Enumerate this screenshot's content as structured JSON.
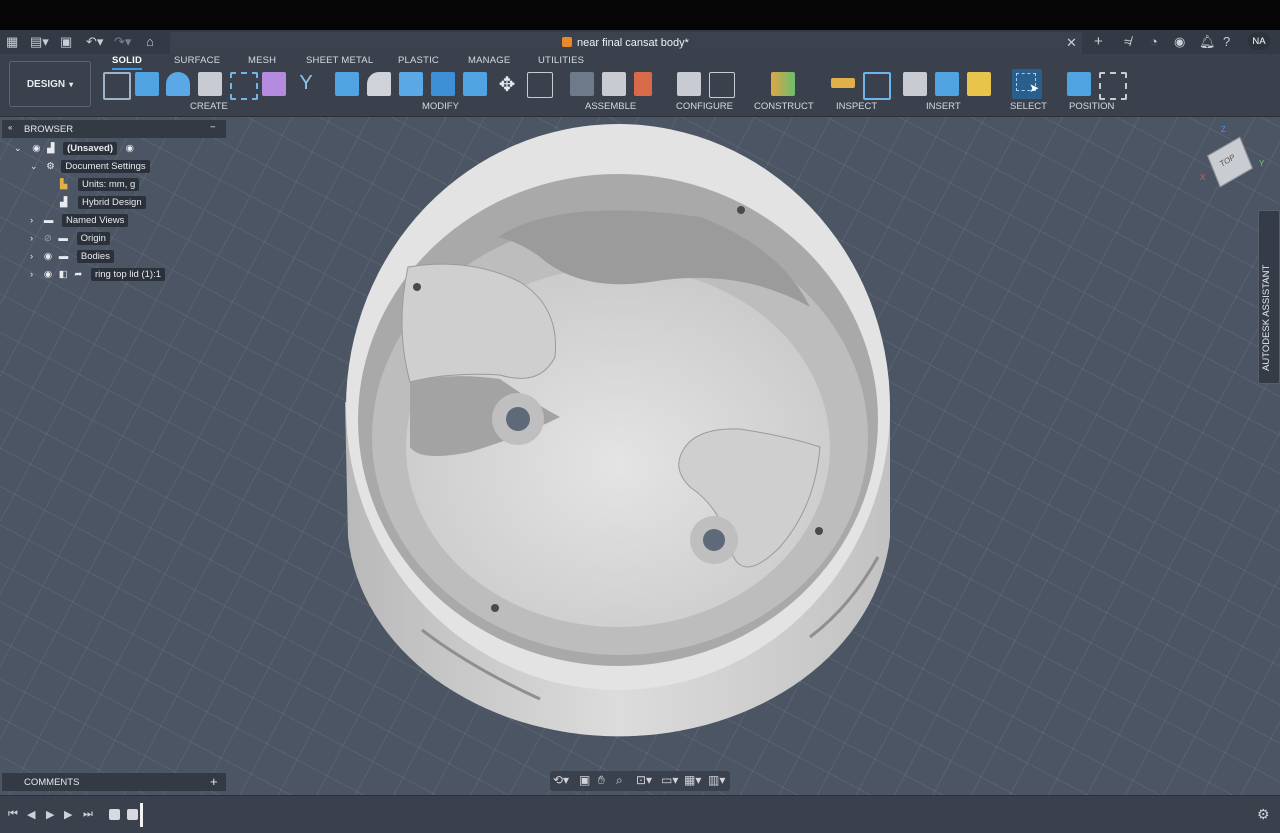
{
  "app": {
    "document_title": "near final cansat body*",
    "user_initials": "NA"
  },
  "workspace_tabs": [
    "SOLID",
    "SURFACE",
    "MESH",
    "SHEET METAL",
    "PLASTIC",
    "MANAGE",
    "UTILITIES"
  ],
  "design_button": "DESIGN",
  "toolbar_groups": [
    "CREATE",
    "MODIFY",
    "ASSEMBLE",
    "CONFIGURE",
    "CONSTRUCT",
    "INSPECT",
    "INSERT",
    "SELECT",
    "POSITION"
  ],
  "browser": {
    "title": "BROWSER",
    "root": "(Unsaved)",
    "document_settings": "Document Settings",
    "units": "Units: mm, g",
    "hybrid": "Hybrid Design",
    "named_views": "Named Views",
    "origin": "Origin",
    "bodies": "Bodies",
    "component": "ring top lid (1):1"
  },
  "comments_label": "COMMENTS",
  "assistant_label": "AUTODESK ASSISTANT",
  "viewcube": {
    "face": "TOP",
    "axis_z": "Z",
    "axis_y": "Y",
    "axis_x": "X"
  },
  "colors": {
    "accent": "#3b9ae8",
    "background": "#4c5563",
    "model": "#d8d8d8"
  }
}
